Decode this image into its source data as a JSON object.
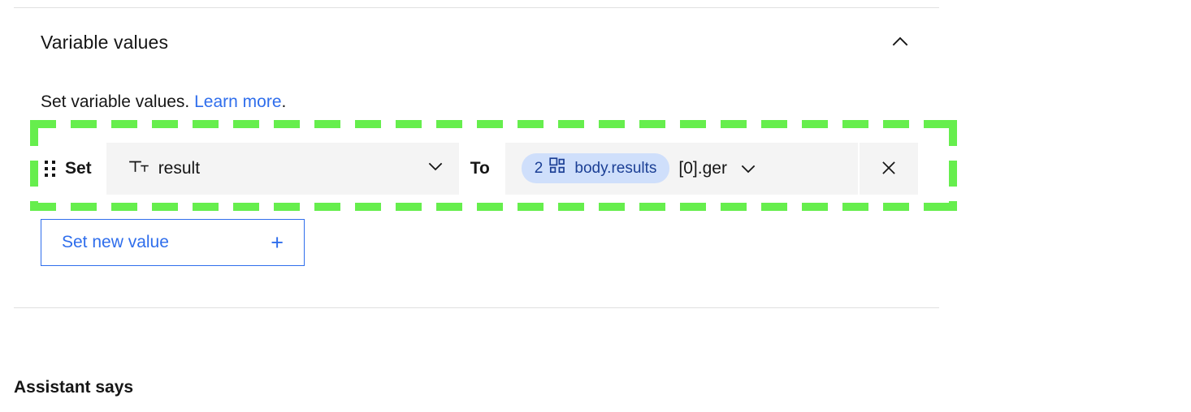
{
  "section": {
    "title": "Variable values",
    "collapse_icon": "chevron-up-icon",
    "description_prefix": "Set variable values. ",
    "description_link": "Learn more",
    "description_suffix": "."
  },
  "variable_row": {
    "drag_handle_icon": "drag-handle-icon",
    "set_label": "Set",
    "to_label": "To",
    "name_field": {
      "type_icon": "text-type-icon",
      "value": "result",
      "chevron_icon": "chevron-down-icon"
    },
    "value_field": {
      "token_number": "2",
      "token_icon": "blocks-icon",
      "token_label": "body.results",
      "trailing_text": "[0].ger",
      "chevron_icon": "chevron-down-icon"
    },
    "remove_icon": "close-icon"
  },
  "add_button": {
    "label": "Set new value",
    "icon": "plus-icon"
  },
  "footer": {
    "assistant_says": "Assistant says"
  },
  "annotation": {
    "type": "highlight-box",
    "color": "#66ee4d",
    "style": "dashed"
  },
  "colors": {
    "accent_blue": "#2f6eec",
    "token_bg": "#cfdffb",
    "token_text": "#1b3f95",
    "field_bg": "#f4f4f4",
    "divider": "#e0e0e0",
    "text": "#161616",
    "highlight": "#66ee4d"
  }
}
